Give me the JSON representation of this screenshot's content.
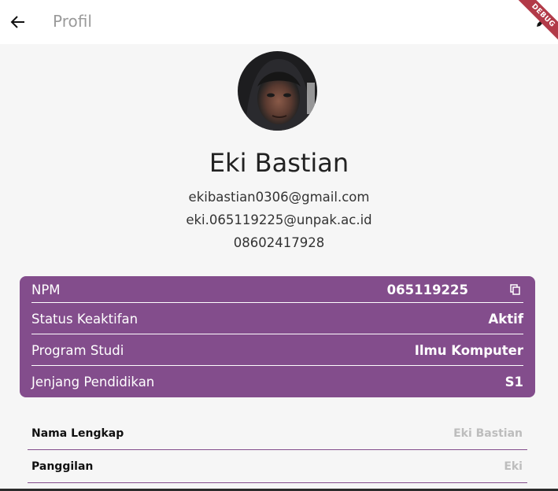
{
  "appbar": {
    "title": "Profil",
    "back_icon": "arrow-left-icon",
    "edit_icon": "edit-pencil-icon",
    "debug_banner": "DEBUG"
  },
  "profile": {
    "name": "Eki Bastian",
    "email_primary": "ekibastian0306@gmail.com",
    "email_campus": "eki.065119225@unpak.ac.id",
    "phone": "08602417928"
  },
  "academic": {
    "rows": [
      {
        "label": "NPM",
        "value": "065119225",
        "action_icon": "copy-icon"
      },
      {
        "label": "Status Keaktifan",
        "value": "Aktif"
      },
      {
        "label": "Program Studi",
        "value": "Ilmu Komputer"
      },
      {
        "label": "Jenjang Pendidikan",
        "value": "S1"
      }
    ]
  },
  "details": {
    "rows": [
      {
        "label": "Nama Lengkap",
        "value": "Eki Bastian"
      },
      {
        "label": "Panggilan",
        "value": "Eki"
      }
    ]
  },
  "colors": {
    "accent": "#834d8c",
    "appbar_bg": "#ffffff",
    "page_bg": "#f6f6f6",
    "debug_banner": "#b23a48",
    "muted_value": "#bdbdbd"
  }
}
